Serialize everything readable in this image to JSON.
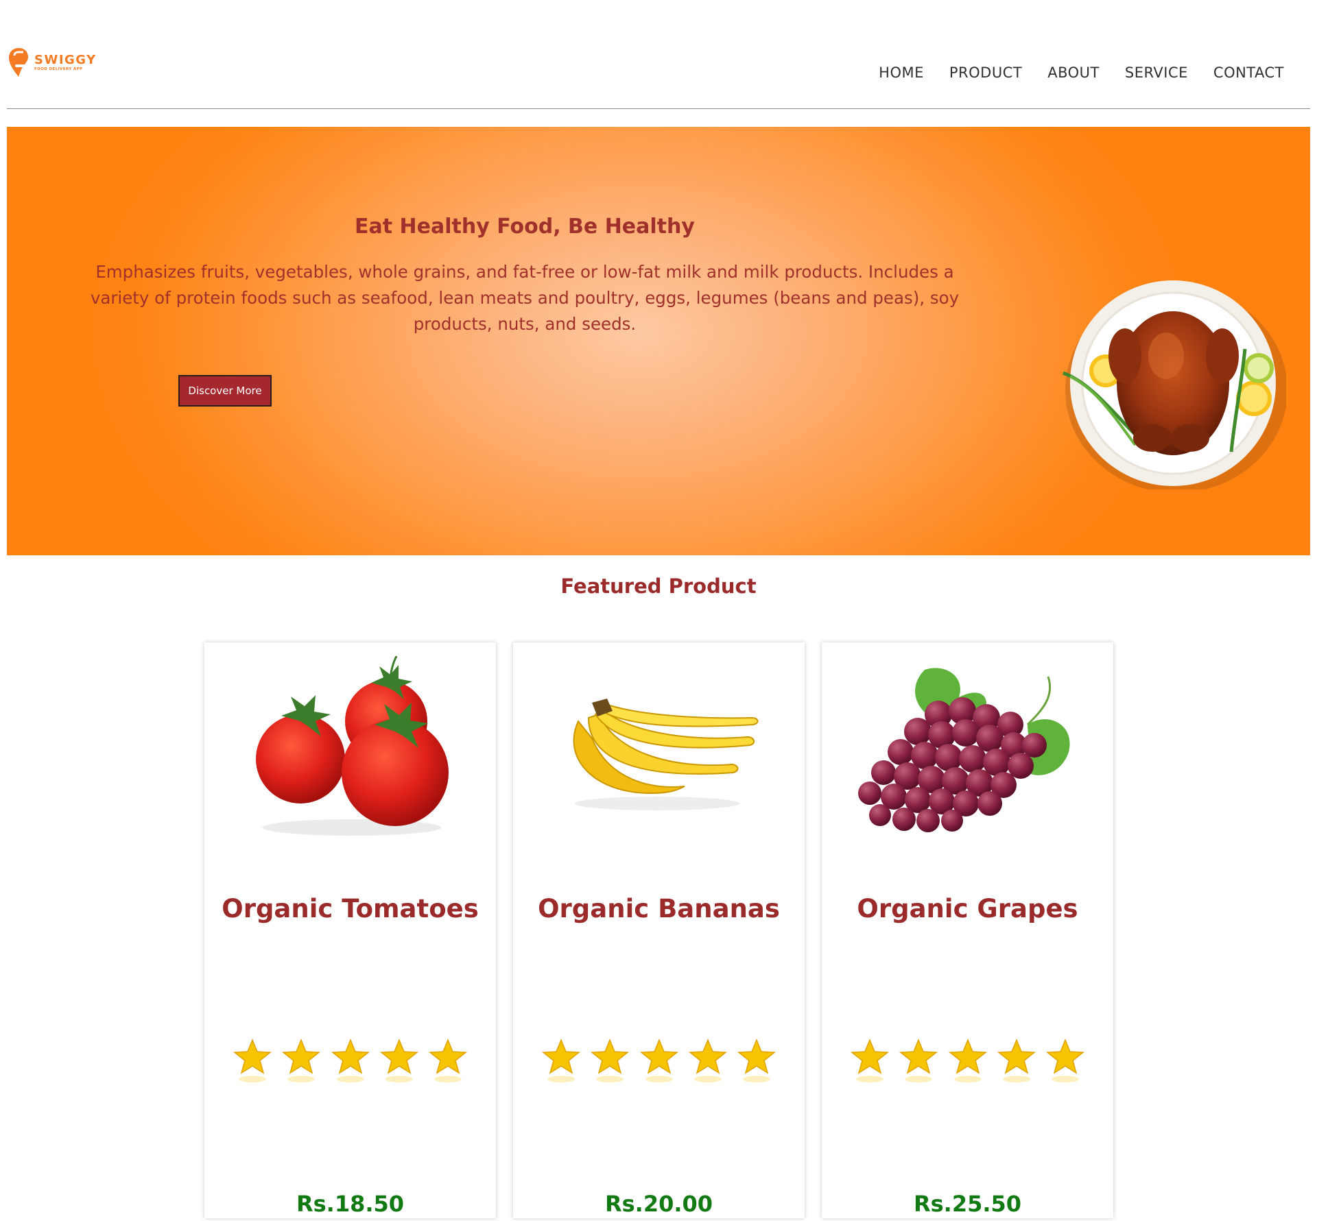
{
  "brand": {
    "name": "SWIGGY",
    "tagline": "FOOD DELIVERY APP",
    "color": "#f47b24"
  },
  "nav": [
    {
      "label": "HOME"
    },
    {
      "label": "PRODUCT"
    },
    {
      "label": "ABOUT"
    },
    {
      "label": "SERVICE"
    },
    {
      "label": "CONTACT"
    }
  ],
  "hero": {
    "title": "Eat Healthy Food, Be Healthy",
    "text": "Emphasizes fruits, vegetables, whole grains, and fat-free or low-fat milk and milk products. Includes a variety of protein foods such as seafood, lean meats and poultry, eggs, legumes (beans and peas), soy products, nuts, and seeds.",
    "button": "Discover More",
    "image_icon": "roast-chicken-plate-icon"
  },
  "featured": {
    "title": "Featured Product",
    "products": [
      {
        "name": "Organic Tomatoes",
        "price": "Rs.18.50",
        "rating": 5,
        "image_icon": "tomatoes-icon"
      },
      {
        "name": "Organic Bananas",
        "price": "Rs.20.00",
        "rating": 5,
        "image_icon": "bananas-icon"
      },
      {
        "name": "Organic Grapes",
        "price": "Rs.25.50",
        "rating": 5,
        "image_icon": "grapes-icon"
      }
    ]
  },
  "colors": {
    "accent": "#a0302c",
    "hero_orange": "#ff8210",
    "price_green": "#127a12",
    "button": "#a4282d"
  }
}
